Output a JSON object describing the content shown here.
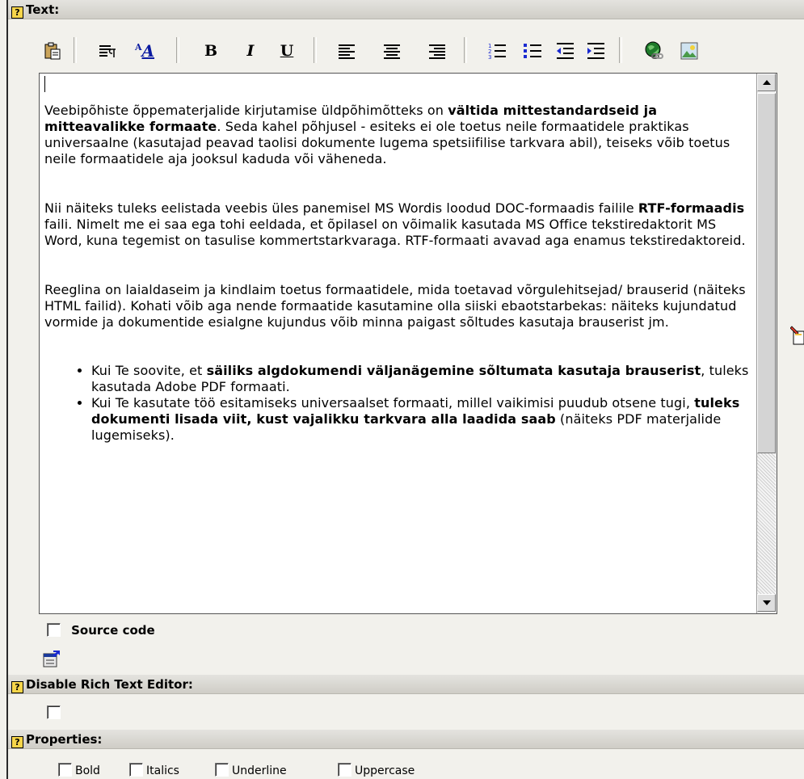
{
  "text_section": {
    "title": "Text:"
  },
  "toolbar": {
    "items": [
      "paste-icon",
      "paragraph-format-icon",
      "font-style-icon",
      "bold-icon",
      "italic-icon",
      "underline-icon",
      "align-left-icon",
      "align-center-icon",
      "align-right-icon",
      "numbered-list-icon",
      "bullet-list-icon",
      "outdent-icon",
      "indent-icon",
      "insert-link-icon",
      "insert-image-icon"
    ],
    "bold_glyph": "B",
    "italic_glyph": "I",
    "underline_glyph": "U",
    "font_glyph_small": "A",
    "font_glyph_big": "A"
  },
  "editor": {
    "p1_a": "Veebipõhiste õppematerjalide kirjutamise üldpõhimõtteks on ",
    "p1_b": "vältida mittestandardseid ja mitteavalikke formaate",
    "p1_c": ". Seda kahel põhjusel - esiteks ei ole toetus neile formaatidele praktikas universaalne (kasutajad peavad taolisi dokumente lugema spetsiifilise tarkvara abil), teiseks võib toetus neile formaatidele aja jooksul kaduda või väheneda.",
    "p2_a": "Nii näiteks tuleks eelistada veebis üles panemisel MS Wordis loodud DOC-formaadis failile ",
    "p2_b": "RTF-formaadis",
    "p2_c": " faili. Nimelt me ei saa ega tohi eeldada, et õpilasel on võimalik kasutada MS Office tekstiredaktorit MS Word, kuna tegemist on tasulise kommertstarkvaraga. RTF-formaati avavad aga enamus tekstiredaktoreid.",
    "p3": "Reeglina on laialdaseim ja kindlaim toetus formaatidele, mida toetavad võrgulehitsejad/ brauserid (näiteks HTML failid). Kohati võib aga nende formaatide kasutamine olla siiski ebaotstarbekas: näiteks kujundatud vormide ja dokumentide esialgne kujundus võib minna paigast sõltudes kasutaja brauserist jm.",
    "li1_a": "Kui Te soovite, et ",
    "li1_b": "säiliks algdokumendi väljanägemine sõltumata kasutaja brauserist",
    "li1_c": ", tuleks kasutada Adobe PDF formaati.",
    "li2_a": "Kui Te kasutate töö esitamiseks universaalset formaati, millel vaikimisi puudub otsene tugi, ",
    "li2_b": "tuleks dokumenti lisada viit, kust vajalikku tarkvara alla laadida saab",
    "li2_c": " (näiteks PDF materjalide lugemiseks)."
  },
  "source_code": {
    "label": "Source code",
    "checked": false
  },
  "disable_rte": {
    "title": "Disable Rich Text Editor:",
    "checked": false
  },
  "properties": {
    "title": "Properties:",
    "options": [
      "Bold",
      "Italics",
      "Underline",
      "Uppercase"
    ]
  },
  "help_glyph": "?"
}
